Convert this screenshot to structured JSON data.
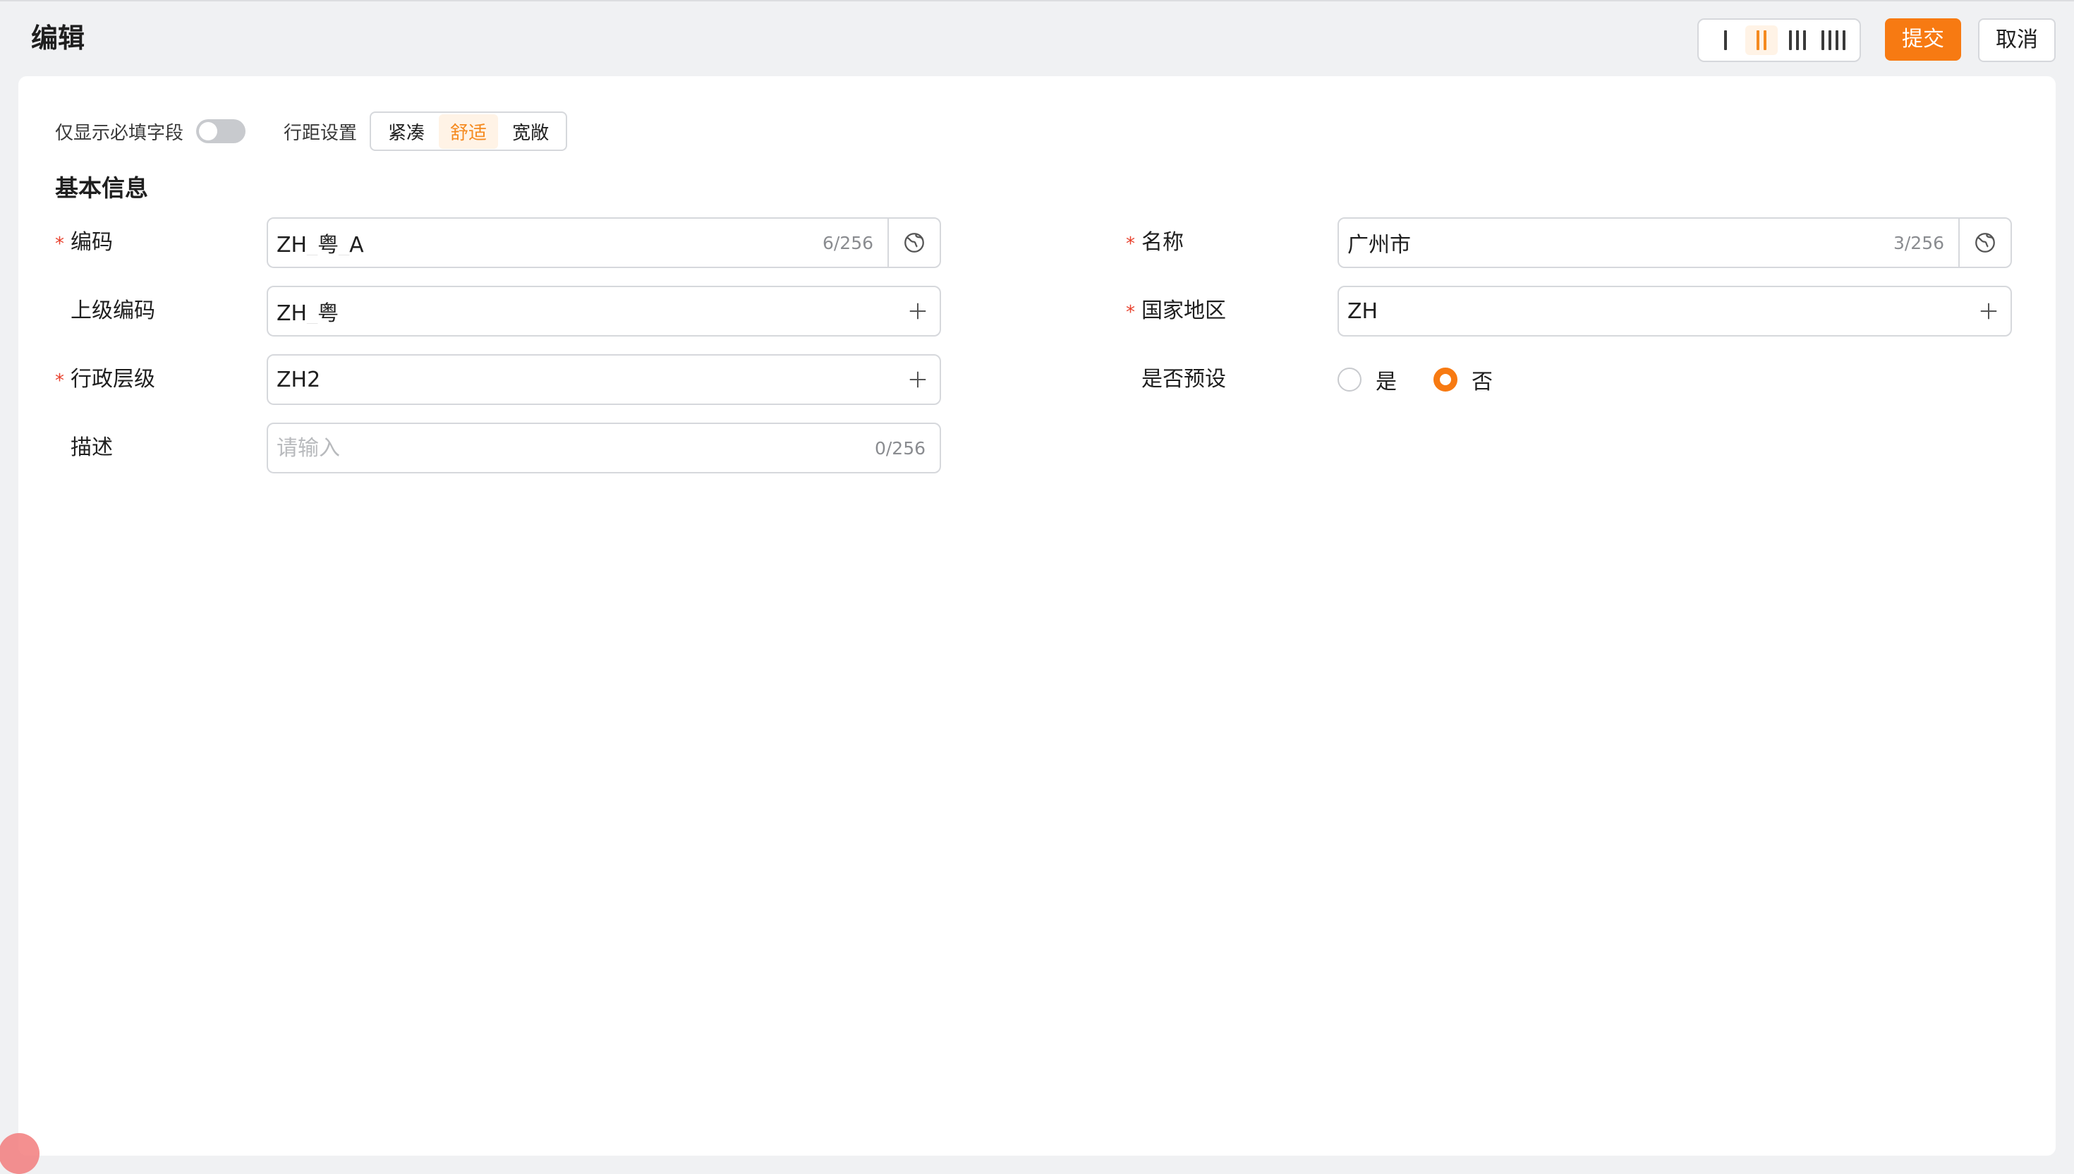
{
  "header": {
    "title": "编辑",
    "column_layouts": [
      "1",
      "2",
      "3",
      "4"
    ],
    "active_columns": "2",
    "submit_label": "提交",
    "cancel_label": "取消"
  },
  "toolbar": {
    "required_only_label": "仅显示必填字段",
    "required_only_on": false,
    "density_label": "行距设置",
    "density_options": [
      "紧凑",
      "舒适",
      "宽敞"
    ],
    "density_selected": "舒适"
  },
  "section": {
    "title": "基本信息"
  },
  "fields": {
    "code": {
      "label": "编码",
      "required": true,
      "value": "ZH_粤_A",
      "counter": "6/256",
      "icon": "translate-globe-icon"
    },
    "parent_code": {
      "label": "上级编码",
      "required": false,
      "value": "ZH_粤",
      "icon": "plus-icon"
    },
    "admin_level": {
      "label": "行政层级",
      "required": true,
      "value": "ZH2",
      "icon": "plus-icon"
    },
    "description": {
      "label": "描述",
      "required": false,
      "value": "",
      "placeholder": "请输入",
      "counter": "0/256"
    },
    "name": {
      "label": "名称",
      "required": true,
      "value": "广州市",
      "counter": "3/256",
      "icon": "translate-globe-icon"
    },
    "country": {
      "label": "国家地区",
      "required": true,
      "value": "ZH",
      "icon": "plus-icon"
    },
    "is_preset": {
      "label": "是否预设",
      "required": false,
      "options": [
        "是",
        "否"
      ],
      "selected": "否"
    }
  },
  "colors": {
    "accent": "#f77a12",
    "required_star": "#e8412d",
    "border": "#d6d8dc"
  }
}
